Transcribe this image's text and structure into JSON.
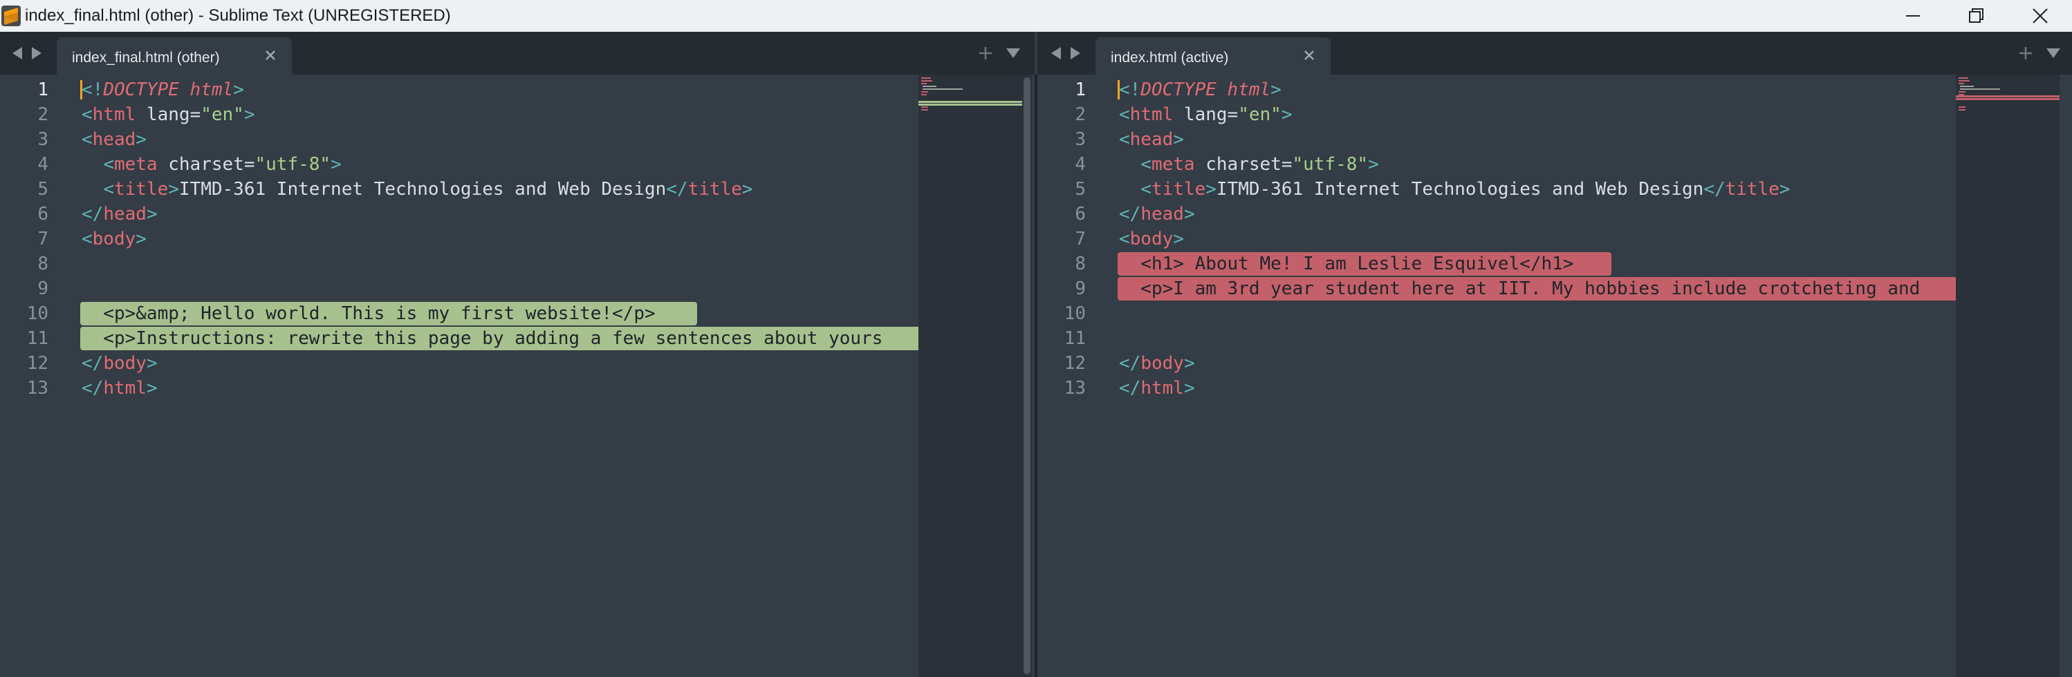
{
  "window": {
    "title": "index_final.html (other) - Sublime Text (UNREGISTERED)",
    "accent": "#f39c12"
  },
  "left_pane": {
    "tab_label": "index_final.html (other)",
    "lines": [
      {
        "n": "1",
        "text": "<!DOCTYPE html>"
      },
      {
        "n": "2",
        "text": "<html lang=\"en\">"
      },
      {
        "n": "3",
        "text": "<head>"
      },
      {
        "n": "4",
        "text": "  <meta charset=\"utf-8\">"
      },
      {
        "n": "5",
        "text": "  <title>ITMD-361 Internet Technologies and Web Design</title>"
      },
      {
        "n": "6",
        "text": "</head>"
      },
      {
        "n": "7",
        "text": "<body>"
      },
      {
        "n": "8",
        "text": ""
      },
      {
        "n": "9",
        "text": ""
      },
      {
        "n": "10",
        "text": "  <p>&amp; Hello world. This is my first website!</p>"
      },
      {
        "n": "11",
        "text": "  <p>Instructions: rewrite this page by adding a few sentences about yours"
      },
      {
        "n": "12",
        "text": "</body>"
      },
      {
        "n": "13",
        "text": "</html>"
      }
    ],
    "highlight_color": "#a6c18e"
  },
  "right_pane": {
    "tab_label": "index.html (active)",
    "lines": [
      {
        "n": "1",
        "text": "<!DOCTYPE html>"
      },
      {
        "n": "2",
        "text": "<html lang=\"en\">"
      },
      {
        "n": "3",
        "text": "<head>"
      },
      {
        "n": "4",
        "text": "  <meta charset=\"utf-8\">"
      },
      {
        "n": "5",
        "text": "  <title>ITMD-361 Internet Technologies and Web Design</title>"
      },
      {
        "n": "6",
        "text": "</head>"
      },
      {
        "n": "7",
        "text": "<body>"
      },
      {
        "n": "8",
        "text": "  <h1> About Me! I am Leslie Esquivel</h1>"
      },
      {
        "n": "9",
        "text": "  <p>I am 3rd year student here at IIT. My hobbies include crotcheting and"
      },
      {
        "n": "10",
        "text": ""
      },
      {
        "n": "11",
        "text": ""
      },
      {
        "n": "12",
        "text": "</body>"
      },
      {
        "n": "13",
        "text": "</html>"
      }
    ],
    "highlight_color": "#c4606a"
  },
  "icons": {
    "nav_back": "triangle-left-icon",
    "nav_forward": "triangle-right-icon",
    "new_tab": "plus-icon",
    "tab_menu": "triangle-down-icon",
    "close": "close-icon"
  }
}
